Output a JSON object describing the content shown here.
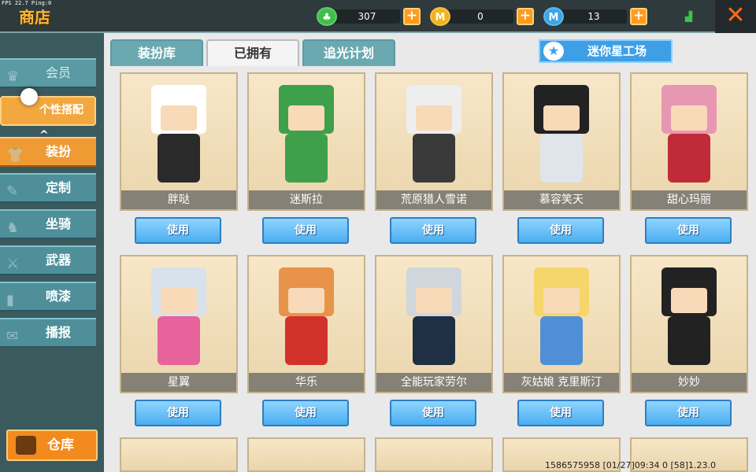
{
  "header": {
    "fps": "FPS 22.7  Ping:0",
    "title": "商店",
    "currencies": [
      {
        "icon": "leaf-coin-icon",
        "glyph": "♣",
        "color": "#3fbf4a",
        "value": "307"
      },
      {
        "icon": "gold-coin-icon",
        "glyph": "M",
        "color": "#f2b21b",
        "value": "0"
      },
      {
        "icon": "mini-bean-icon",
        "glyph": "M",
        "color": "#3aa6e8",
        "value": "13"
      }
    ],
    "plus": "+",
    "close": "✕",
    "signal": "▟"
  },
  "sidebar": {
    "vip": "会员",
    "group": "个性搭配",
    "dress": "装扮",
    "custom": "定制",
    "mount": "坐骑",
    "weapon": "武器",
    "spray": "喷漆",
    "broadcast": "播报",
    "warehouse": "仓库"
  },
  "tabs": {
    "wardrobe": "装扮库",
    "owned": "已拥有",
    "plan": "追光计划",
    "workshop": "迷你星工场"
  },
  "use_label": "使用",
  "items": [
    {
      "name": "胖哒",
      "head": "#ffffff",
      "body": "#2a2a2a"
    },
    {
      "name": "迷斯拉",
      "head": "#3ea04a",
      "body": "#3ea04a"
    },
    {
      "name": "荒原猎人雪诺",
      "head": "#eeeeee",
      "body": "#3a3a3a"
    },
    {
      "name": "慕容笑天",
      "head": "#222222",
      "body": "#dfe5ea"
    },
    {
      "name": "甜心玛丽",
      "head": "#e897b2",
      "body": "#c02b3a"
    },
    {
      "name": "星翼",
      "head": "#d7e2ec",
      "body": "#e6639c"
    },
    {
      "name": "华乐",
      "head": "#e8934a",
      "body": "#d1332b"
    },
    {
      "name": "全能玩家劳尔",
      "head": "#cfd6dc",
      "body": "#1f2f44"
    },
    {
      "name": "灰姑娘 克里斯汀",
      "head": "#f6d66a",
      "body": "#4f8fd8"
    },
    {
      "name": "妙妙",
      "head": "#222222",
      "body": "#222222"
    }
  ],
  "footer": "1586575958  [01/27]09:34 0  [58]1.23.0"
}
